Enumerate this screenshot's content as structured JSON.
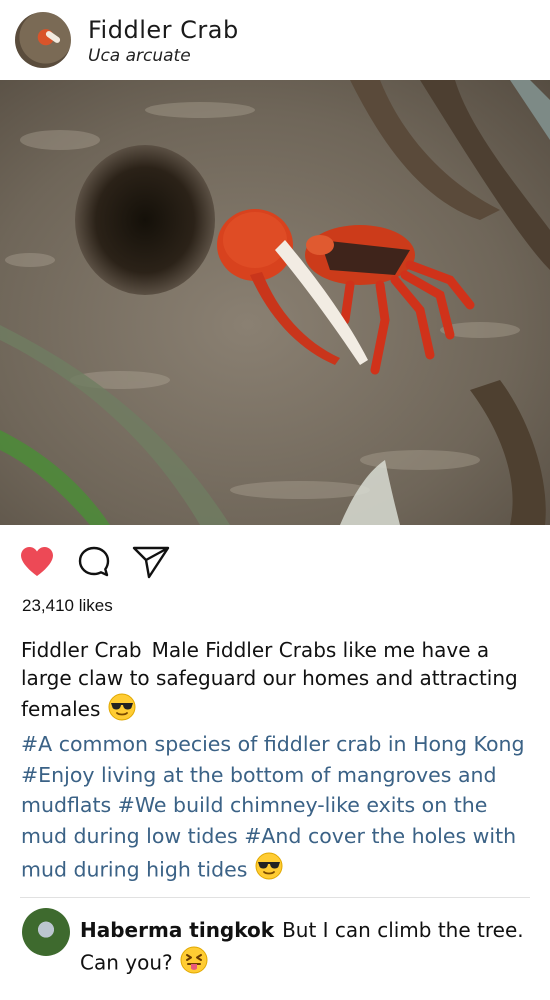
{
  "post": {
    "title": "Fiddler Crab",
    "subtitle": "Uca arcuate"
  },
  "actions": {
    "like_icon": "heart-filled-icon",
    "comment_icon": "comment-bubble-icon",
    "share_icon": "send-icon",
    "like_color": "#ed4956"
  },
  "likes": "23,410 likes",
  "caption": {
    "username": "Fiddler Crab",
    "text": "Male Fiddler Crabs like me have a large claw to safeguard our homes and attracting females",
    "emoji": "sunglasses-emoji",
    "hashtags": "#A common species of fiddler crab in Hong Kong #Enjoy living at the bottom of mangroves and mudflats  #We build chimney-like exits on the mud during low tides   #And cover the holes with mud during high tides",
    "hashtags_emoji": "sunglasses-emoji",
    "hashtag_color": "#3b6286"
  },
  "comment": {
    "username": "Haberma tingkok",
    "text": "But I can climb the tree. Can you?",
    "emoji": "tongue-out-emoji"
  }
}
